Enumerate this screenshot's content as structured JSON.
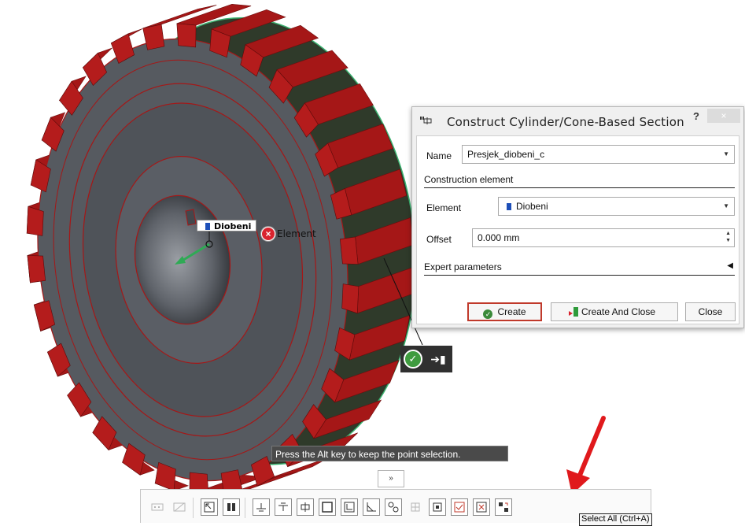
{
  "viewport": {
    "element_tag": "Diobeni",
    "element_caption": "Element",
    "hint": "Press the Alt key to keep the point selection."
  },
  "dialog": {
    "title": "Construct Cylinder/Cone-Based Section",
    "help": "?",
    "close": "×",
    "name_label": "Name",
    "name_value": "Presjek_diobeni_c",
    "section_construction": "Construction element",
    "element_label": "Element",
    "element_value": "Diobeni",
    "offset_label": "Offset",
    "offset_value": "0.000 mm",
    "expert_label": "Expert parameters",
    "expert_toggle": "◀",
    "create_label": "Create",
    "create_close_label": "Create And Close",
    "close_label": "Close"
  },
  "toolbar": {
    "expander": "»",
    "tooltip": "Select All (Ctrl+A)"
  },
  "colors": {
    "gear_body": "#565a60",
    "gear_teeth": "#a51717",
    "selection_green": "#3cb371",
    "annotation_red": "#e0191c"
  }
}
